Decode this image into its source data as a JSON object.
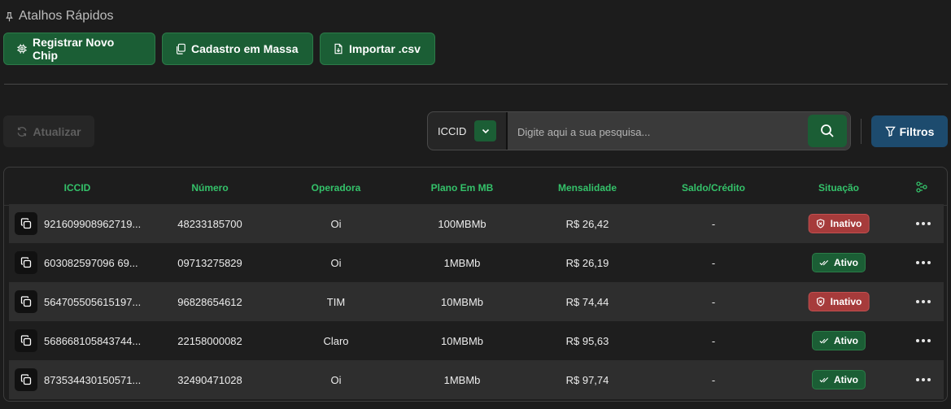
{
  "shortcuts": {
    "title": "Atalhos Rápidos",
    "icon": "pin-icon",
    "buttons": [
      {
        "label": "Registrar Novo Chip",
        "icon": "chip-icon"
      },
      {
        "label": "Cadastro em Massa",
        "icon": "copy-files-icon"
      },
      {
        "label": "Importar .csv",
        "icon": "file-import-icon"
      }
    ]
  },
  "toolbar": {
    "refresh_label": "Atualizar",
    "search_field": "ICCID",
    "search_placeholder": "Digite aqui a sua pesquisa...",
    "filters_label": "Filtros"
  },
  "table": {
    "columns": [
      "ICCID",
      "Número",
      "Operadora",
      "Plano Em MB",
      "Mensalidade",
      "Saldo/Crédito",
      "Situação"
    ],
    "rows": [
      {
        "iccid": "921609908962719...",
        "numero": "48233185700",
        "operadora": "Oi",
        "plano": "100MBMb",
        "mensalidade": "R$ 26,42",
        "saldo": "-",
        "situacao": "Inativo",
        "status": "inactive"
      },
      {
        "iccid": "603082597096 69...",
        "numero": "09713275829",
        "operadora": "Oi",
        "plano": "1MBMb",
        "mensalidade": "R$ 26,19",
        "saldo": "-",
        "situacao": "Ativo",
        "status": "active"
      },
      {
        "iccid": "564705505615197...",
        "numero": "96828654612",
        "operadora": "TIM",
        "plano": "10MBMb",
        "mensalidade": "R$ 74,44",
        "saldo": "-",
        "situacao": "Inativo",
        "status": "inactive"
      },
      {
        "iccid": "568668105843744...",
        "numero": "22158000082",
        "operadora": "Claro",
        "plano": "10MBMb",
        "mensalidade": "R$ 95,63",
        "saldo": "-",
        "situacao": "Ativo",
        "status": "active"
      },
      {
        "iccid": "873534430150571...",
        "numero": "32490471028",
        "operadora": "Oi",
        "plano": "1MBMb",
        "mensalidade": "R$ 97,74",
        "saldo": "-",
        "situacao": "Ativo",
        "status": "active"
      }
    ]
  },
  "colors": {
    "accent_green": "#1b5e35",
    "header_green": "#34c26a",
    "filters_blue": "#1d4b6e",
    "inactive_red": "#a63b3b"
  }
}
